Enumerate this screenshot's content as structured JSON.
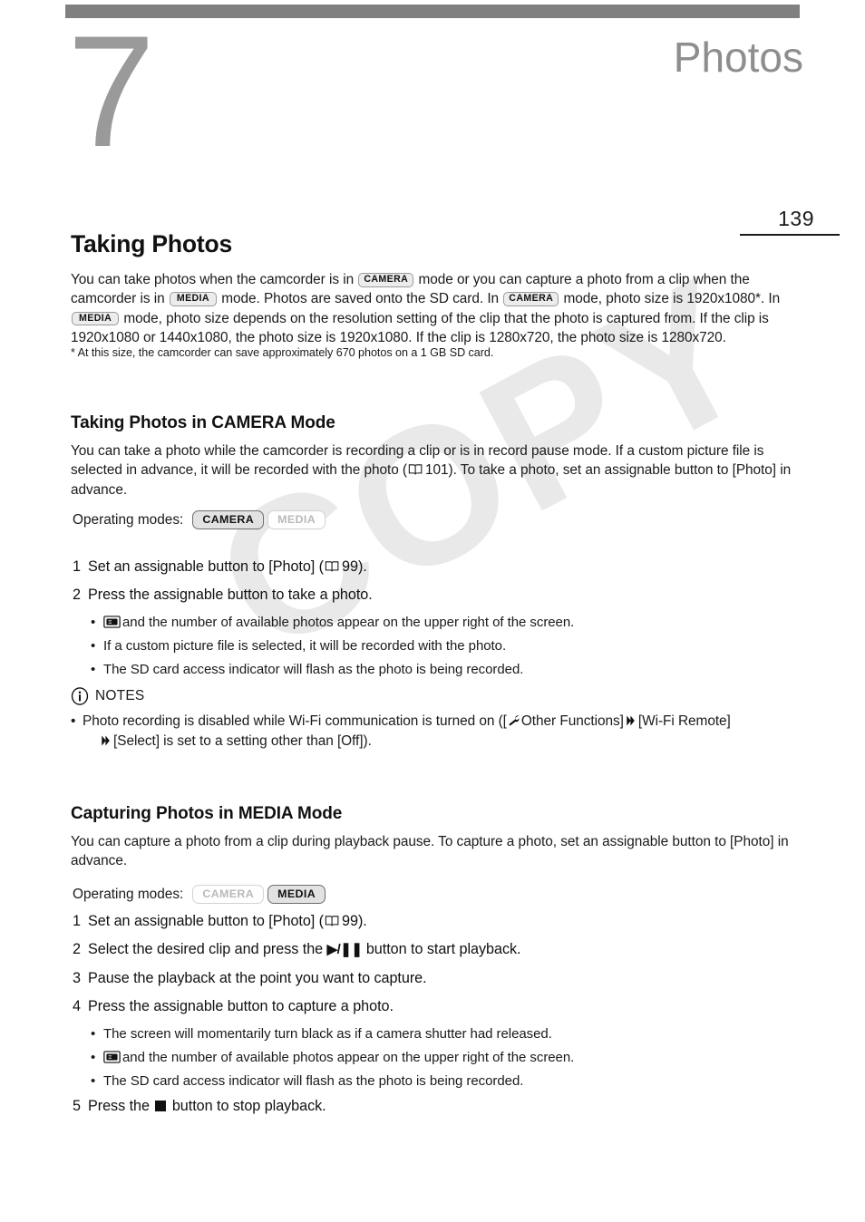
{
  "page": {
    "chapter_number": "7",
    "chapter_title": "Photos",
    "page_number": "139"
  },
  "watermark": {
    "text": "COPY"
  },
  "section_main": {
    "heading": "Taking Photos",
    "intro_part1": "You can take photos when the camcorder is in",
    "badge_camera_1": "CAMERA",
    "intro_part2": "mode or you can capture a photo from a clip when the camcorder is in",
    "badge_media_1": "MEDIA",
    "intro_part3": "mode. Photos are saved onto the SD card. In",
    "badge_camera_2": "CAMERA",
    "intro_part4": "mode, photo size is 1920x1080*. In",
    "badge_media_2": "MEDIA",
    "intro_part5": "mode, photo size depends on the resolution setting of the clip that the photo is captured from. If the clip is 1920x1080 or 1440x1080, the photo size is 1920x1080. If the clip is 1280x720, the photo size is 1280x720.",
    "footnote": "*  At this size, the camcorder can save approximately 670 photos on a 1 GB SD card."
  },
  "section_camera": {
    "heading": "Taking Photos in CAMERA Mode",
    "intro_part1": "You can take a photo while the camcorder is recording a clip or is in record pause mode. If a custom picture file is selected in advance, it will be recorded with the photo (",
    "page_ref": "101",
    "intro_part2": "). To take a photo, set an assignable button to [Photo] in advance.",
    "operating_modes_label": "Operating modes:",
    "badge_camera": "CAMERA",
    "badge_media": "MEDIA",
    "badge_camera_state": "on",
    "badge_media_state": "off",
    "steps": [
      {
        "num": "1",
        "text_before": "Set an assignable button to [Photo] (",
        "page_ref": "99",
        "text_after": ")."
      },
      {
        "num": "2",
        "text_before": "Press the assignable button to take a photo.",
        "page_ref": "",
        "text_after": ""
      }
    ],
    "bullets": [
      {
        "has_sd_icon": true,
        "text": "and the number of available photos appear on the upper right of the screen."
      },
      {
        "has_sd_icon": false,
        "text": "If a custom picture file is selected, it will be recorded with the photo."
      },
      {
        "has_sd_icon": false,
        "text": "The SD card access indicator will flash as the photo is being recorded."
      }
    ],
    "notes": {
      "label": "NOTES",
      "text_a": "Photo recording is disabled while Wi-Fi communication is turned on ([",
      "text_b": "Other Functions]",
      "text_c": "[Wi-Fi Remote]",
      "text_d": "[Select] is set to a setting other than [Off])."
    }
  },
  "section_media": {
    "heading": "Capturing Photos in MEDIA Mode",
    "intro": "You can capture a photo from a clip during playback pause. To capture a photo, set an assignable button to [Photo] in advance.",
    "operating_modes_label": "Operating modes:",
    "badge_camera": "CAMERA",
    "badge_media": "MEDIA",
    "badge_camera_state": "off",
    "badge_media_state": "on",
    "step1": {
      "num": "1",
      "text_before": "Set an assignable button to [Photo] (",
      "page_ref": "99",
      "text_after": ")."
    },
    "step2": {
      "num": "2",
      "text_before": "Select the desired clip and press the",
      "glyph": "▶/❚❚",
      "text_after": "button to start playback."
    },
    "step3": {
      "num": "3",
      "text": "Pause the playback at the point you want to capture."
    },
    "step4": {
      "num": "4",
      "text": "Press the assignable button to capture a photo."
    },
    "bullets": [
      {
        "has_sd_icon": false,
        "text": "The screen will momentarily turn black as if a camera shutter had released."
      },
      {
        "has_sd_icon": true,
        "text": "and the number of available photos appear on the upper right of the screen."
      },
      {
        "has_sd_icon": false,
        "text": "The SD card access indicator will flash as the photo is being recorded."
      }
    ],
    "step5": {
      "num": "5",
      "text_before": "Press the",
      "text_after": "button to stop playback."
    }
  },
  "icons": {
    "book": "book-icon",
    "sd_card": "sd-card-icon",
    "info": "info-circle-icon",
    "wrench": "wrench-icon",
    "chevron": "double-chevron-right-icon",
    "play_pause": "play-pause-icon",
    "stop": "stop-square-icon"
  },
  "colors": {
    "top_bar": "#808080",
    "chapter_number": "#9a9a9a",
    "chapter_title": "#8e8e8e",
    "body_text": "#1a1a1a",
    "watermark": "#e9e9e9"
  }
}
